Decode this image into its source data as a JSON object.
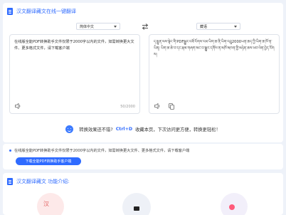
{
  "header": {
    "title": "汉文翻译藏文在线一键翻译"
  },
  "languages": {
    "source": "简体中文",
    "target": "藏语"
  },
  "source_panel": {
    "text": "在线版全能PDF转换助手文件仅限于2000字以内的文件，如需转换更大文件、更多格式文件，请下载客户端",
    "counter": "50/2000"
  },
  "target_panel": {
    "text": "ད་རྒྱུན་ལས་སྟེང་གི་PDFསྒྱུར་བཟོ་རོགས་རམ་ཡིག་ཆ་ནི་ཡིག་འབྲུ2000ཡན་ཆད་ཀྱི་ཡིག་ཆ་ཁོ་ན་ཡིན། ཡིག་ཆ་ཆེ་བ་དང་རྣམ་གཞག་མང་བ་སྒྱུར་དགོས་ན་མཁོ་མཁན་གྱི་མཉེན་ཆས་ཕབ་ལེན་བྱེད་རོགས།"
  },
  "tip": {
    "before": "转换效果还不错?",
    "shortcut": "Ctrl+D",
    "after": "收藏本页，下次访问更方便，转换更轻松！"
  },
  "promo": {
    "text": "在线版全能PDF转换助手文件仅限于2000字以内的文件，如需转换更大文件、更多格式文件，请下载客户端",
    "button": "下载全能PDF转换助手客户端"
  },
  "intro": {
    "title": "汉文翻译藏文 功能介绍:",
    "thumb_label": "汉"
  },
  "colors": {
    "accent": "#2f6bff",
    "background": "#eef2f9"
  },
  "icons": [
    "document-icon",
    "swap-icon",
    "speaker-icon",
    "copy-icon",
    "smile-icon"
  ]
}
